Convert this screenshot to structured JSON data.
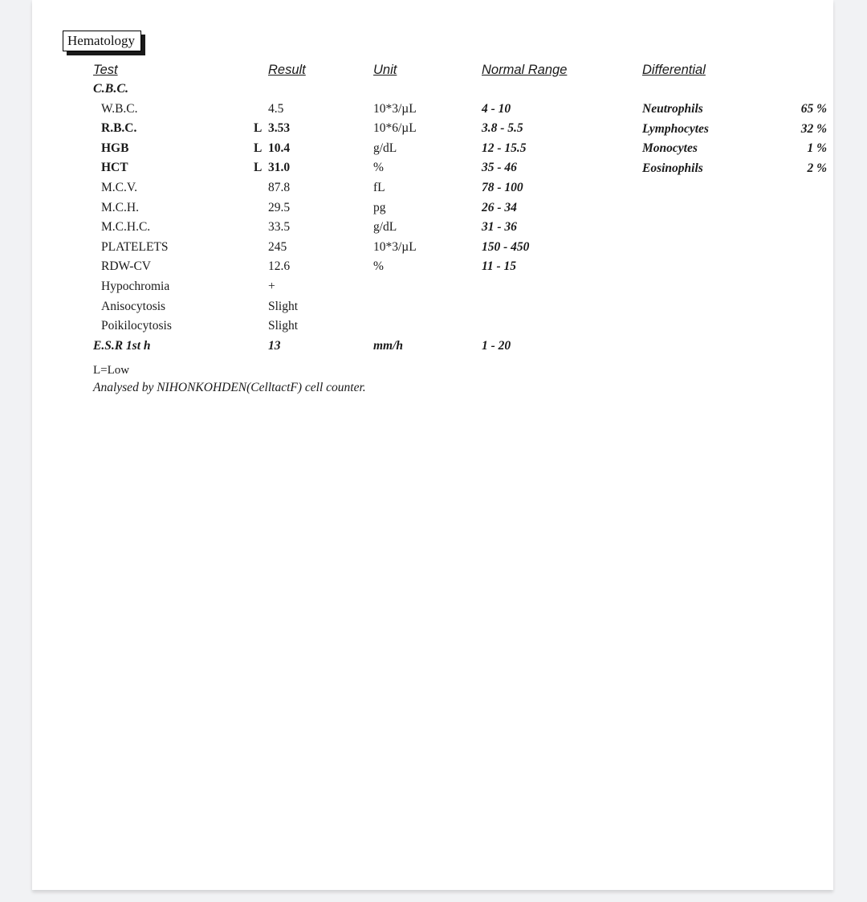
{
  "document": {
    "title_box": "Hematology",
    "headers": {
      "test": "Test",
      "result": "Result",
      "unit": "Unit",
      "normal_range": "Normal Range",
      "differential": "Differential"
    }
  },
  "cbc": {
    "group_label": "C.B.C.",
    "rows": [
      {
        "test": "W.B.C.",
        "flag": "",
        "result": "4.5",
        "unit": "10*3/µL",
        "range": "4 - 10",
        "abnormal": false
      },
      {
        "test": "R.B.C.",
        "flag": "L",
        "result": "3.53",
        "unit": "10*6/µL",
        "range": "3.8 - 5.5",
        "abnormal": true
      },
      {
        "test": "HGB",
        "flag": "L",
        "result": "10.4",
        "unit": "g/dL",
        "range": "12 - 15.5",
        "abnormal": true
      },
      {
        "test": "HCT",
        "flag": "L",
        "result": "31.0",
        "unit": "%",
        "range": "35 - 46",
        "abnormal": true
      },
      {
        "test": "M.C.V.",
        "flag": "",
        "result": "87.8",
        "unit": "fL",
        "range": "78 - 100",
        "abnormal": false
      },
      {
        "test": "M.C.H.",
        "flag": "",
        "result": "29.5",
        "unit": "pg",
        "range": "26 - 34",
        "abnormal": false
      },
      {
        "test": "M.C.H.C.",
        "flag": "",
        "result": "33.5",
        "unit": "g/dL",
        "range": "31 - 36",
        "abnormal": false
      },
      {
        "test": "PLATELETS",
        "flag": "",
        "result": "245",
        "unit": "10*3/µL",
        "range": "150 - 450",
        "abnormal": false
      },
      {
        "test": "RDW-CV",
        "flag": "",
        "result": "12.6",
        "unit": "%",
        "range": "11 - 15",
        "abnormal": false
      },
      {
        "test": "Hypochromia",
        "flag": "",
        "result": "+",
        "unit": "",
        "range": "",
        "abnormal": false
      },
      {
        "test": "Anisocytosis",
        "flag": "",
        "result": "Slight",
        "unit": "",
        "range": "",
        "abnormal": false
      },
      {
        "test": "Poikilocytosis",
        "flag": "",
        "result": "Slight",
        "unit": "",
        "range": "",
        "abnormal": false
      }
    ]
  },
  "esr": {
    "test": "E.S.R 1st h",
    "result": "13",
    "unit": "mm/h",
    "range": "1 - 20"
  },
  "differential": {
    "rows": [
      {
        "name": "Neutrophils",
        "value": "65 %"
      },
      {
        "name": "Lymphocytes",
        "value": "32 %"
      },
      {
        "name": "Monocytes",
        "value": "1 %"
      },
      {
        "name": "Eosinophils",
        "value": "2 %"
      }
    ]
  },
  "notes": {
    "legend": "L=Low",
    "analyser": "Analysed by NIHONKOHDEN(CelltactF) cell counter."
  }
}
